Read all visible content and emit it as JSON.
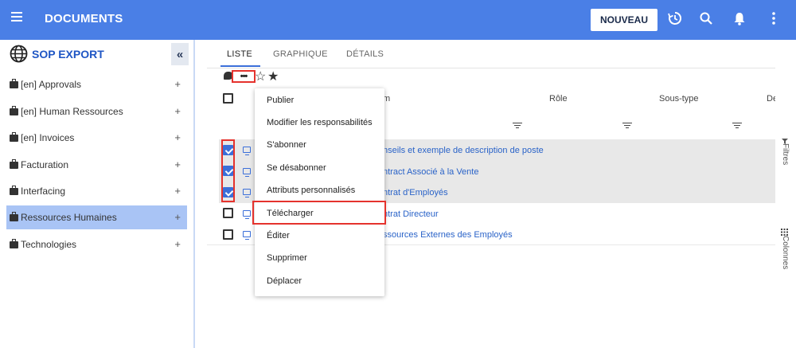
{
  "header": {
    "title": "DOCUMENTS",
    "new_button": "NOUVEAU",
    "accent": "#4a7fe6"
  },
  "sidebar": {
    "title": "SOP EXPORT",
    "collapse_glyph": "«",
    "items": [
      {
        "label": "[en] Approvals",
        "icon": "briefcase-icon"
      },
      {
        "label": "[en] Human Ressources",
        "icon": "briefcase-icon"
      },
      {
        "label": "[en] Invoices",
        "icon": "briefcase-icon"
      },
      {
        "label": "Facturation",
        "icon": "briefcase-icon"
      },
      {
        "label": "Interfacing",
        "icon": "briefcase-icon"
      },
      {
        "label": "Ressources Humaines",
        "icon": "briefcase-icon",
        "active": true
      },
      {
        "label": "Technologies",
        "icon": "briefcase-icon"
      }
    ],
    "plus_glyph": "+"
  },
  "tabs": [
    {
      "label": "LISTE",
      "active": true
    },
    {
      "label": "GRAPHIQUE"
    },
    {
      "label": "DÉTAILS"
    }
  ],
  "toolbar": {
    "more_glyph": "•••",
    "star_outline": "☆",
    "star_solid": "★"
  },
  "table": {
    "columns": [
      "m",
      "Rôle",
      "Sous-type",
      "Des"
    ],
    "rows": [
      {
        "title": "nseils et exemple de description de poste",
        "checked": true
      },
      {
        "title": "ntract Associé à la Vente",
        "checked": true
      },
      {
        "title": "ntrat d'Employés",
        "checked": true
      },
      {
        "title": "ntrat Directeur",
        "checked": false
      },
      {
        "title": "ssources Externes des Employés",
        "checked": false
      }
    ]
  },
  "context_menu": {
    "items": [
      "Publier",
      "Modifier les responsabilités",
      "S'abonner",
      "Se désabonner",
      "Attributs personnalisés",
      "Télécharger",
      "Éditer",
      "Supprimer",
      "Déplacer"
    ],
    "highlighted": "Télécharger"
  },
  "right_rail": {
    "filters": "Filtres",
    "columns": "Colonnes"
  },
  "colors": {
    "highlight_border": "#e5322d",
    "selection": "#a9c4f5",
    "link": "#2a63c8"
  }
}
